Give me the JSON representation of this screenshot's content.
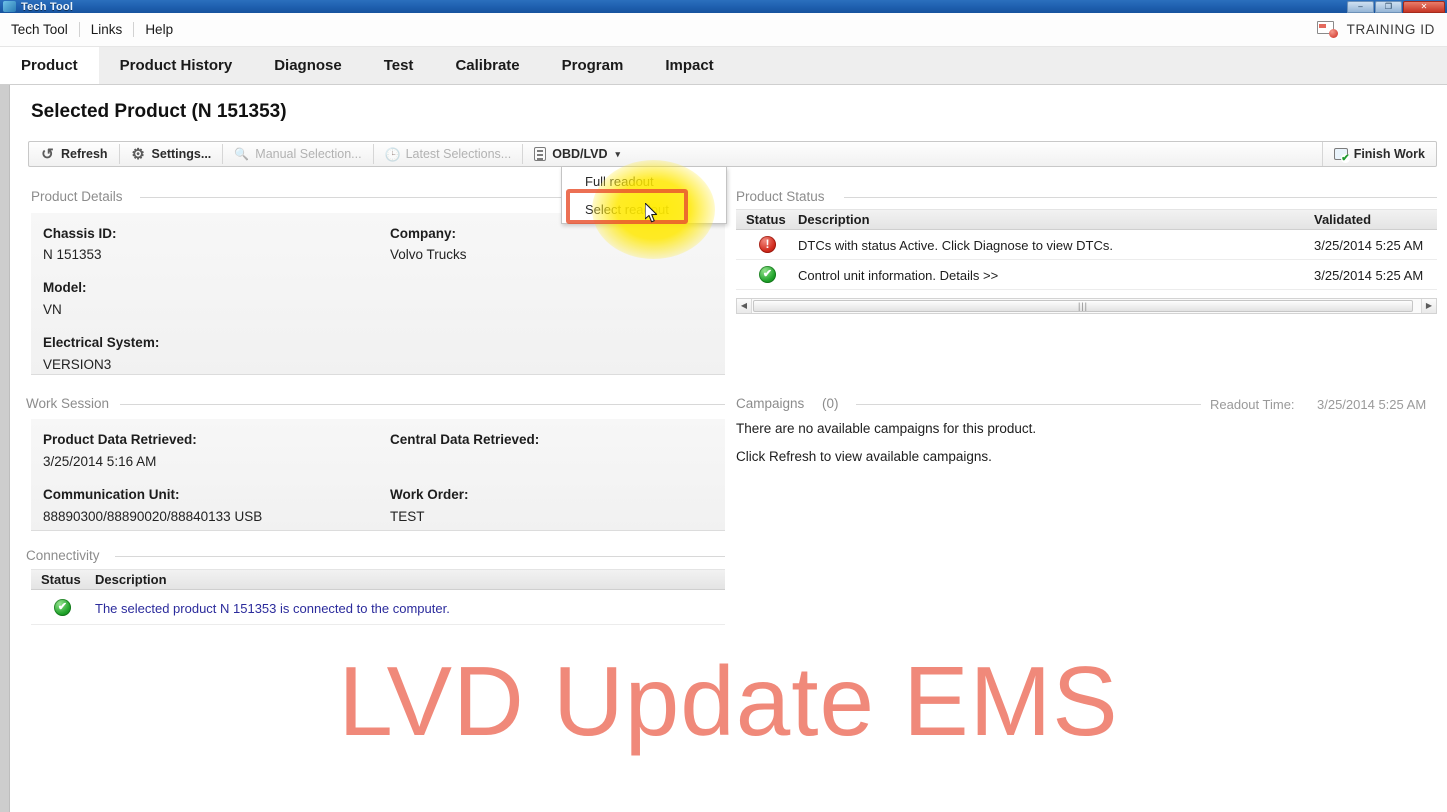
{
  "window": {
    "title": "Tech Tool",
    "minimize_label": "–",
    "maximize_label": "❐",
    "close_label": "✕"
  },
  "menubar": {
    "items": [
      {
        "label": "Tech Tool"
      },
      {
        "label": "Links"
      },
      {
        "label": "Help"
      }
    ],
    "training_id": "TRAINING ID"
  },
  "tabs": [
    {
      "label": "Product",
      "active": true
    },
    {
      "label": "Product History",
      "active": false
    },
    {
      "label": "Diagnose",
      "active": false
    },
    {
      "label": "Test",
      "active": false
    },
    {
      "label": "Calibrate",
      "active": false
    },
    {
      "label": "Program",
      "active": false
    },
    {
      "label": "Impact",
      "active": false
    }
  ],
  "page": {
    "title": "Selected Product (N 151353)"
  },
  "toolbar": {
    "refresh": "Refresh",
    "settings": "Settings...",
    "manual_selection": "Manual Selection...",
    "latest_selections": "Latest Selections...",
    "obd_lvd": "OBD/LVD",
    "obd_caret": "▾",
    "finish_work": "Finish Work"
  },
  "dropdown": {
    "items": [
      {
        "label": "Full readout",
        "highlighted": false
      },
      {
        "label": "Select readout",
        "highlighted": true
      }
    ]
  },
  "product_details": {
    "section_label": "Product Details",
    "fields": [
      {
        "label": "Chassis ID:",
        "value": "N 151353"
      },
      {
        "label": "Company:",
        "value": "Volvo Trucks"
      },
      {
        "label": "Model:",
        "value": "VN"
      },
      {
        "label": "Electrical System:",
        "value": "VERSION3"
      }
    ]
  },
  "product_status": {
    "section_label": "Product Status",
    "columns": [
      "Status",
      "Description",
      "Validated"
    ],
    "rows": [
      {
        "status_icon": "error-icon",
        "description": "DTCs with status Active. Click Diagnose to view DTCs.",
        "validated": "3/25/2014 5:25 AM"
      },
      {
        "status_icon": "success-icon",
        "description": "Control unit information. Details >>",
        "validated": "3/25/2014 5:25 AM"
      }
    ],
    "scrollbar": {
      "left_arrow": "◀",
      "right_arrow": "▶",
      "grip": "|||"
    }
  },
  "work_session": {
    "section_label": "Work Session",
    "fields": [
      {
        "label": "Product Data Retrieved:",
        "value": "3/25/2014 5:16 AM"
      },
      {
        "label": "Central Data Retrieved:",
        "value": ""
      },
      {
        "label": "Communication Unit:",
        "value": "88890300/88890020/88840133 USB"
      },
      {
        "label": "Work Order:",
        "value": "TEST"
      }
    ]
  },
  "campaigns": {
    "section_label": "Campaigns",
    "count": "(0)",
    "readout_time_label": "Readout Time:",
    "readout_time_value": "3/25/2014 5:25 AM",
    "lines": [
      "There are no available campaigns for this product.",
      "Click Refresh to view available campaigns."
    ]
  },
  "connectivity": {
    "section_label": "Connectivity",
    "columns": [
      "Status",
      "Description"
    ],
    "rows": [
      {
        "status_icon": "success-icon",
        "description": "The selected product N 151353 is connected to the computer."
      }
    ]
  },
  "watermark": {
    "text": "LVD Update EMS",
    "color": "#f0897a"
  },
  "colors": {
    "accent_blue": "#1e5fae",
    "highlight_border": "#e8502e",
    "glow": "#ffeb00",
    "status_error": "#d22b1d",
    "status_ok": "#20a32a"
  }
}
